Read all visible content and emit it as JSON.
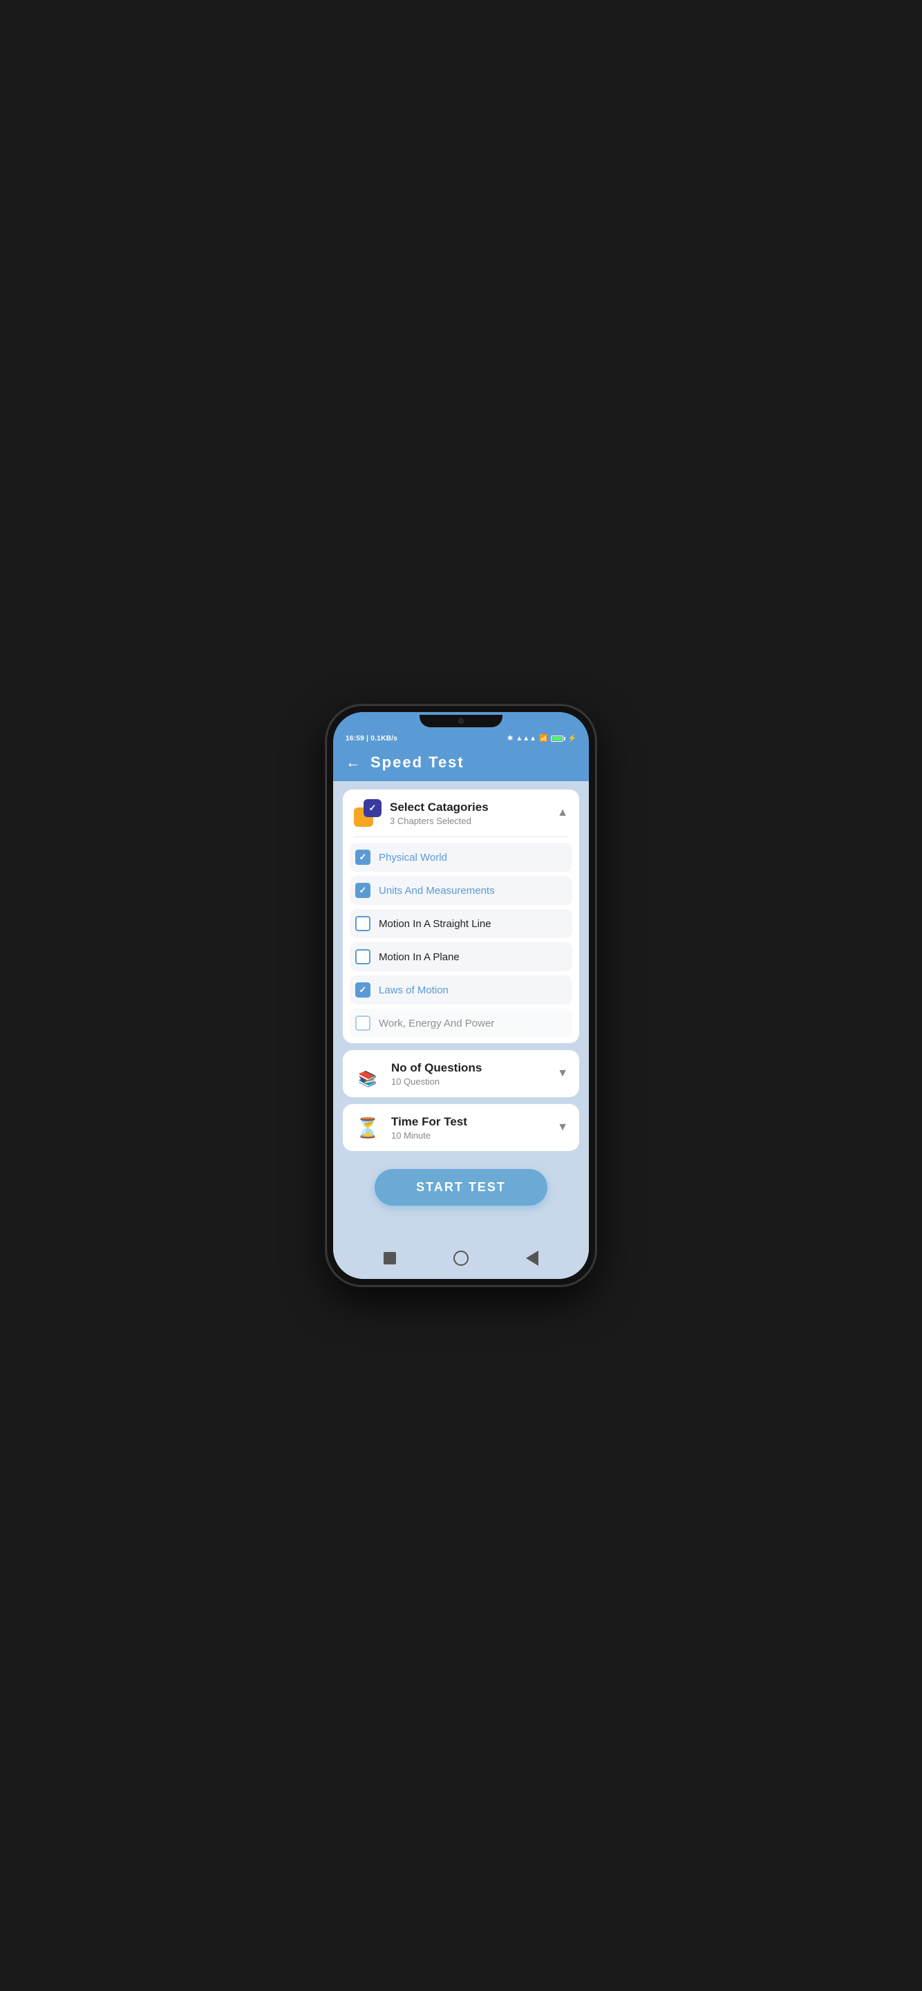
{
  "statusBar": {
    "time": "16:59 | 0.1KB/s",
    "bluetooth": "bluetooth",
    "signal": "signal",
    "wifi": "wifi",
    "battery": "100"
  },
  "header": {
    "title": "Speed  Test",
    "backLabel": "←"
  },
  "categories": {
    "sectionTitle": "Select Catagories",
    "subtitle": "3 Chapters Selected",
    "chapters": [
      {
        "name": "Physical World",
        "checked": true
      },
      {
        "name": "Units And Measurements",
        "checked": true
      },
      {
        "name": "Motion In A Straight Line",
        "checked": false
      },
      {
        "name": "Motion In A Plane",
        "checked": false
      },
      {
        "name": "Laws of Motion",
        "checked": true
      },
      {
        "name": "Work, Energy And Power",
        "checked": false
      }
    ]
  },
  "questions": {
    "title": "No of Questions",
    "subtitle": "10 Question"
  },
  "timeForTest": {
    "title": "Time For Test",
    "subtitle": "10 Minute"
  },
  "startButton": {
    "label": "START TEST"
  }
}
